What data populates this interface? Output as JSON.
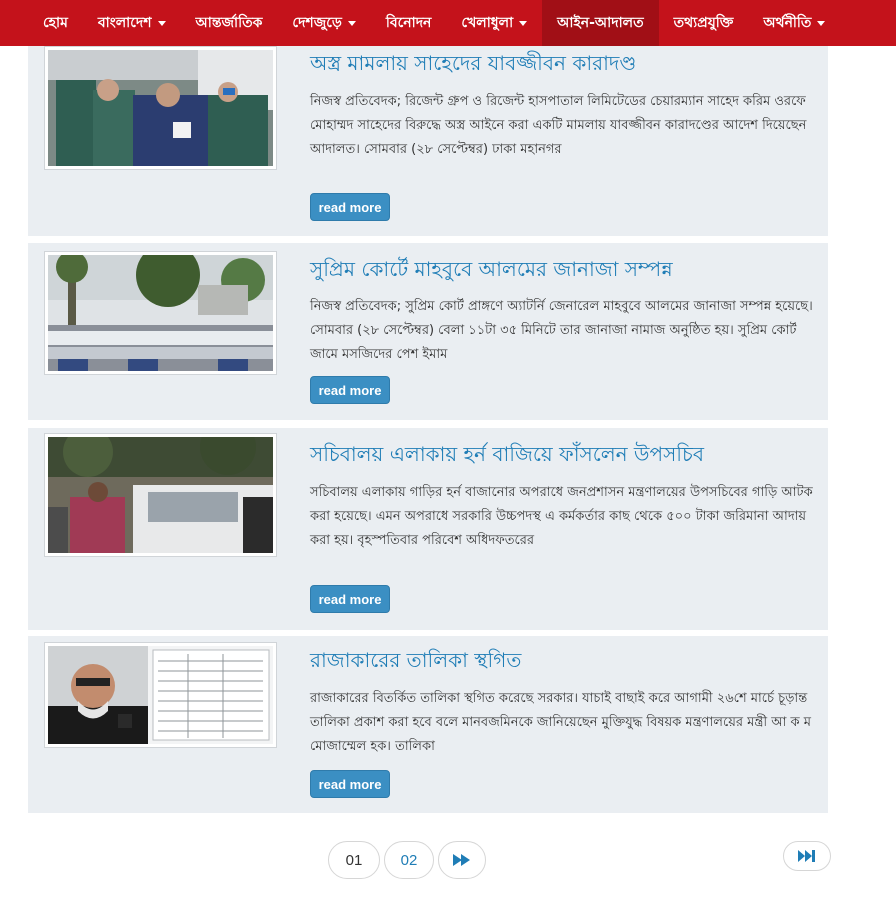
{
  "nav": {
    "items": [
      {
        "label": "হোম",
        "dropdown": false,
        "active": false
      },
      {
        "label": "বাংলাদেশ",
        "dropdown": true,
        "active": false
      },
      {
        "label": "আন্তর্জাতিক",
        "dropdown": false,
        "active": false
      },
      {
        "label": "দেশজুড়ে",
        "dropdown": true,
        "active": false
      },
      {
        "label": "বিনোদন",
        "dropdown": false,
        "active": false
      },
      {
        "label": "খেলাধুলা",
        "dropdown": true,
        "active": false
      },
      {
        "label": "আইন-আদালত",
        "dropdown": false,
        "active": true
      },
      {
        "label": "তথ্যপ্রযুক্তি",
        "dropdown": false,
        "active": false
      },
      {
        "label": "অর্থনীতি",
        "dropdown": true,
        "active": false
      }
    ]
  },
  "articles": [
    {
      "title": "অস্ত্র মামলায় সাহেদের যাবজ্জীবন কারাদণ্ড",
      "excerpt": "নিজস্ব প্রতিবেদক; রিজেন্ট গ্রুপ ও রিজেন্ট হাসপাতাল লিমিটেডের চেয়ারম্যান সাহেদ করিম ওরফে মোহাম্মদ সাহেদের বিরুদ্ধে অস্ত্র আইনে করা একটি মামলায় যাবজ্জীবন কারাদণ্ডের আদেশ দিয়েছেন আদালত। সোমবার (২৮ সেপ্টেম্বর) ঢাকা মহানগর",
      "read_more": "read more",
      "image": "police-escort-photo"
    },
    {
      "title": "সুপ্রিম কোর্টে মাহবুবে আলমের জানাজা সম্পন্ন",
      "excerpt": "নিজস্ব প্রতিবেদক; সুপ্রিম কোর্ট প্রাঙ্গণে অ্যাটর্নি জেনারেল মাহবুবে আলমের জানাজা সম্পন্ন হয়েছে। সোমবার (২৮ সেপ্টেম্বর) বেলা ১১টা ৩৫ মিনিটে তার জানাজা নামাজ অনুষ্ঠিত হয়। সুপ্রিম কোর্ট জামে মসজিদের পেশ ইমাম",
      "read_more": "read more",
      "image": "funeral-prayer-photo"
    },
    {
      "title": "সচিবালয় এলাকায় হর্ন বাজিয়ে ফাঁসলেন উপসচিব",
      "excerpt": "সচিবালয় এলাকায় গাড়ির হর্ন বাজানোর অপরাধে জনপ্রশাসন মন্ত্রণালয়ের উপসচিবের গাড়ি আটক করা হয়েছে। এমন অপরাধে সরকারি উচ্চপদস্থ এ কর্মকর্তার কাছ থেকে ৫০০ টাকা জরিমানা আদায় করা হয়। বৃহস্পতিবার পরিবেশ অধিদফতরের",
      "read_more": "read more",
      "image": "car-street-photo"
    },
    {
      "title": "রাজাকারের তালিকা স্থগিত",
      "excerpt": "রাজাকারের বিতর্কিত তালিকা স্থগিত করেছে সরকার। যাচাই বাছাই করে আগামী ২৬শে মার্চে চূড়ান্ত তালিকা প্রকাশ করা হবে বলে মানবজমিনকে জানিয়েছেন মুক্তিযুদ্ধ বিষয়ক মন্ত্রণালয়ের মন্ত্রী আ ক ম মোজাম্মেল হক। তালিকা",
      "read_more": "read more",
      "image": "minister-and-list-photo"
    }
  ],
  "pagination": {
    "pages": [
      "01",
      "02"
    ],
    "current": "02",
    "next_icon": "fast-forward-icon",
    "last_icon": "skip-to-end-icon"
  },
  "colors": {
    "nav_bg": "#c4121b",
    "nav_active_bg": "#a10f16",
    "card_bg": "#eaeef2",
    "headline": "#1f7db6",
    "button": "#3b8fc3"
  }
}
